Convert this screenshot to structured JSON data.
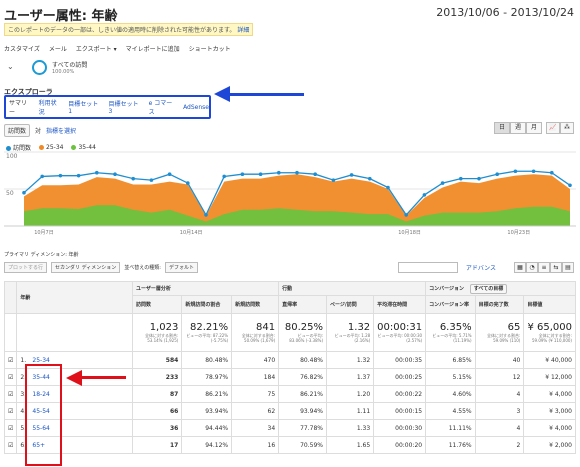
{
  "header": {
    "title": "ユーザー属性: 年齢",
    "date_range": "2013/10/06 - 2013/10/24",
    "notice": "このレポートのデータの一部は、しきい値の適用時に削除された可能性があります。",
    "notice_link": "詳細"
  },
  "actions": [
    "カスタマイズ",
    "メール",
    "エクスポート ▾",
    "マイレポートに追加",
    "ショートカット"
  ],
  "segment": {
    "name": "すべての訪問",
    "pct": "100.00%"
  },
  "explorer": {
    "label": "エクスプローラ",
    "tabs": [
      "サマリー",
      "利用状況",
      "目標セット 1",
      "目標セット 3",
      "e コマース",
      "AdSense"
    ]
  },
  "chart_controls": {
    "metric": "訪問数",
    "vs": "対",
    "select_metric": "指標を選択",
    "granularity": [
      "日",
      "週",
      "月"
    ]
  },
  "chart_data": {
    "type": "area",
    "x_labels": [
      "10月7日",
      "10月14日",
      "10月18日",
      "10月23日"
    ],
    "y_ticks": [
      "100",
      "50"
    ],
    "ylim": [
      0,
      100
    ],
    "series": [
      {
        "name": "訪問数",
        "color": "#1f8ed0",
        "values": [
          45,
          67,
          68,
          68,
          72,
          70,
          64,
          62,
          70,
          58,
          15,
          67,
          70,
          70,
          72,
          72,
          70,
          62,
          69,
          64,
          52,
          15,
          42,
          58,
          64,
          64,
          70,
          74,
          74,
          72,
          55
        ]
      },
      {
        "name": "25-34",
        "color": "#f08a26",
        "values": [
          40,
          55,
          55,
          56,
          66,
          64,
          56,
          56,
          60,
          56,
          14,
          60,
          64,
          64,
          68,
          70,
          66,
          60,
          64,
          60,
          50,
          14,
          38,
          52,
          60,
          58,
          64,
          68,
          70,
          68,
          50
        ]
      },
      {
        "name": "35-44",
        "color": "#6cc23f",
        "values": [
          20,
          24,
          24,
          23,
          28,
          28,
          22,
          18,
          22,
          14,
          6,
          16,
          22,
          22,
          24,
          22,
          20,
          20,
          18,
          16,
          16,
          6,
          14,
          18,
          18,
          18,
          20,
          24,
          26,
          26,
          20
        ]
      }
    ]
  },
  "table_area": {
    "primary_dim": "プライマリ ディメンション: 年齢",
    "plot_rows": "プロットする行",
    "secondary_dim": "セカンダリ ディメンション",
    "sort_type": "並べ替えの種類:",
    "sort_value": "デフォルト",
    "advanced": "アドバンス"
  },
  "table": {
    "dim_header": "年齢",
    "group_headers": [
      "ユーザー層分析",
      "行動",
      "コンバージョン",
      "すべての目標"
    ],
    "col_headers": [
      "訪問数",
      "新規訪問の割合",
      "新規訪問数",
      "直帰率",
      "ページ/訪問",
      "平均滞在時間",
      "コンバージョン率",
      "目標の完了数",
      "目標値"
    ],
    "totals": [
      {
        "big": "1,023",
        "sub": "全体に対する割合: 53.14% (1,925)"
      },
      {
        "big": "82.21%",
        "sub": "ビューの平均: 87.22% (-5.75%)"
      },
      {
        "big": "841",
        "sub": "全体に対する割合: 50.09% (1,679)"
      },
      {
        "big": "80.25%",
        "sub": "ビューの平均: 83.06% (-3.38%)"
      },
      {
        "big": "1.32",
        "sub": "ビューの平均: 1.28 (2.16%)"
      },
      {
        "big": "00:00:31",
        "sub": "ビューの平均: 00:00:30 (2.57%)"
      },
      {
        "big": "6.35%",
        "sub": "ビューの平均: 5.71% (11.19%)"
      },
      {
        "big": "65",
        "sub": "全体に対する割合: 59.09% (110)"
      },
      {
        "big": "¥ 65,000",
        "sub": "全体に対する割合: 59.09% (¥ 110,000)"
      }
    ],
    "rows": [
      {
        "n": "1.",
        "age": "25-34",
        "v": [
          "584",
          "80.48%",
          "470",
          "80.48%",
          "1.32",
          "00:00:35",
          "6.85%",
          "40",
          "¥ 40,000"
        ]
      },
      {
        "n": "2.",
        "age": "35-44",
        "v": [
          "233",
          "78.97%",
          "184",
          "76.82%",
          "1.37",
          "00:00:25",
          "5.15%",
          "12",
          "¥ 12,000"
        ]
      },
      {
        "n": "3.",
        "age": "18-24",
        "v": [
          "87",
          "86.21%",
          "75",
          "86.21%",
          "1.20",
          "00:00:22",
          "4.60%",
          "4",
          "¥ 4,000"
        ]
      },
      {
        "n": "4.",
        "age": "45-54",
        "v": [
          "66",
          "93.94%",
          "62",
          "93.94%",
          "1.11",
          "00:00:15",
          "4.55%",
          "3",
          "¥ 3,000"
        ]
      },
      {
        "n": "5.",
        "age": "55-64",
        "v": [
          "36",
          "94.44%",
          "34",
          "77.78%",
          "1.33",
          "00:00:30",
          "11.11%",
          "4",
          "¥ 4,000"
        ]
      },
      {
        "n": "6.",
        "age": "65+",
        "v": [
          "17",
          "94.12%",
          "16",
          "70.59%",
          "1.65",
          "00:00:20",
          "11.76%",
          "2",
          "¥ 2,000"
        ]
      }
    ]
  }
}
